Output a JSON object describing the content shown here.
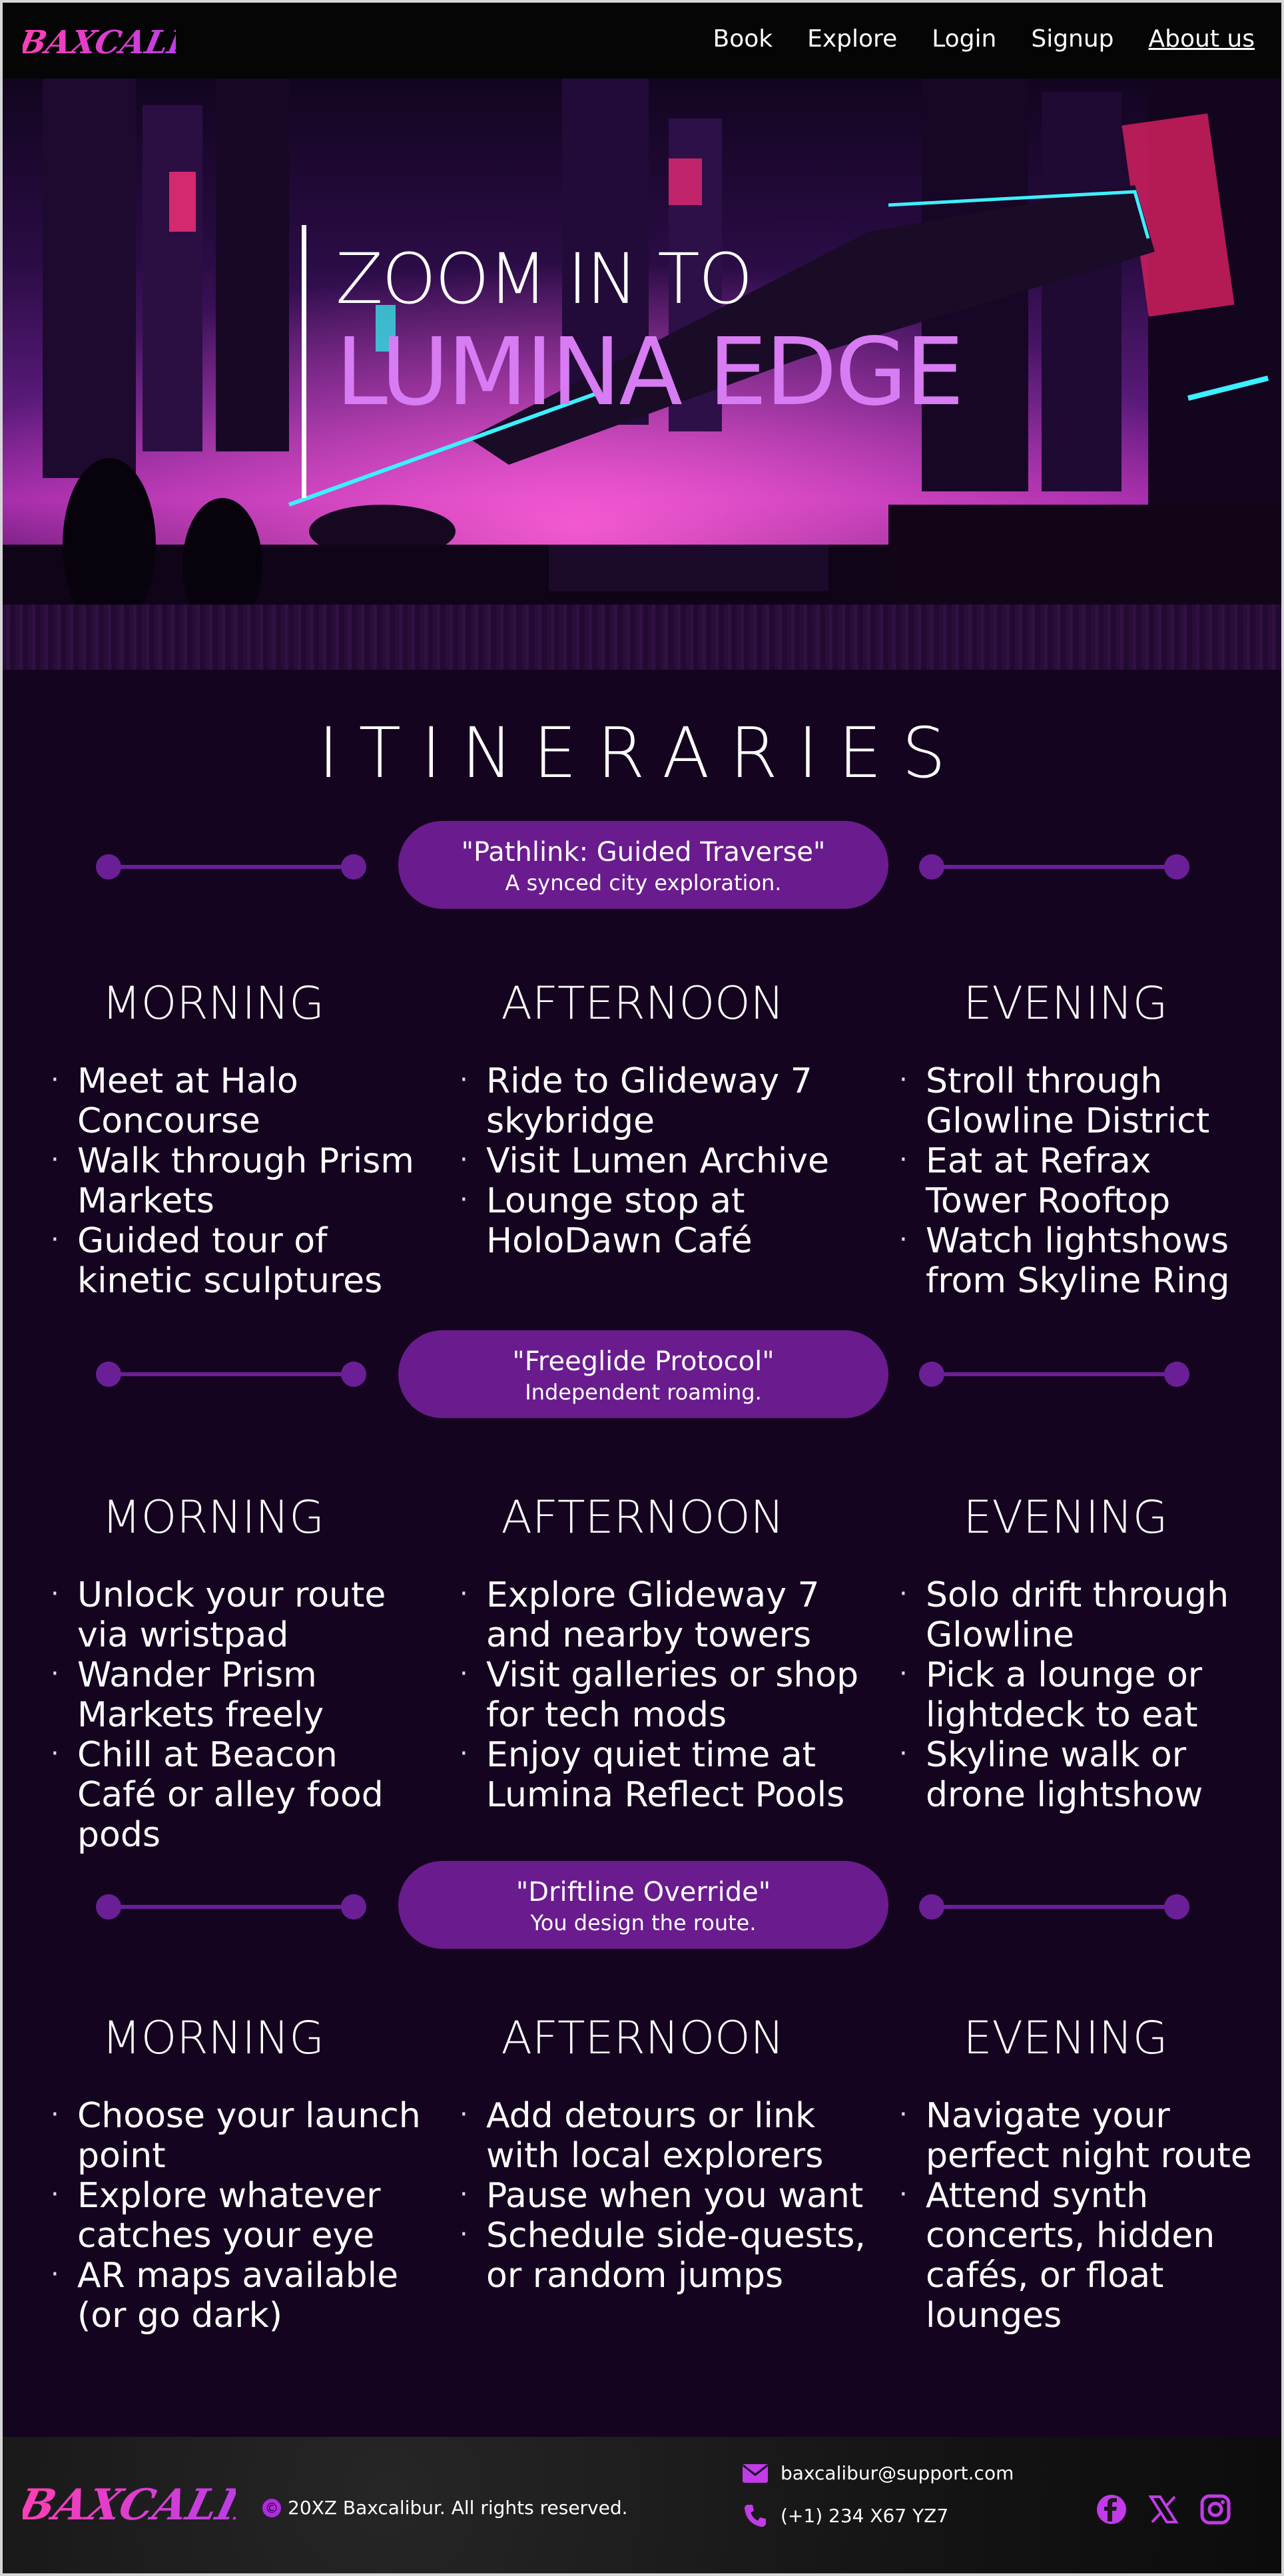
{
  "brand": {
    "name": "Baxcalibur",
    "logo_text": "BAXCALIBUR",
    "colors": {
      "accent": "#d77cf2",
      "pill": "#6a1b8e",
      "bg": "#14041f"
    }
  },
  "nav": {
    "links": [
      {
        "label": "Book"
      },
      {
        "label": "Explore"
      },
      {
        "label": "Login"
      },
      {
        "label": "Signup"
      },
      {
        "label": "About us",
        "active": true
      }
    ]
  },
  "hero": {
    "line1": "ZOOM IN TO",
    "line2": "LUMINA EDGE"
  },
  "section": {
    "title": "ITINERARIES"
  },
  "itineraries": [
    {
      "name": "\"Pathlink: Guided Traverse\"",
      "subtitle": "A synced city exploration.",
      "columns": [
        {
          "heading": "MORNING",
          "items": [
            "Meet at Halo Concourse",
            "Walk through Prism Markets",
            "Guided tour of kinetic sculptures"
          ]
        },
        {
          "heading": "AFTERNOON",
          "items": [
            "Ride to Glideway 7 skybridge",
            "Visit Lumen Archive",
            "Lounge stop at HoloDawn Café"
          ]
        },
        {
          "heading": "EVENING",
          "items": [
            "Stroll through Glowline District",
            "Eat at Refrax Tower Rooftop",
            "Watch lightshows from Skyline Ring"
          ]
        }
      ]
    },
    {
      "name": "\"Freeglide Protocol\"",
      "subtitle": "Independent roaming.",
      "columns": [
        {
          "heading": "MORNING",
          "items": [
            "Unlock your route via wristpad",
            "Wander Prism Markets freely",
            "Chill at Beacon Café or alley food pods"
          ]
        },
        {
          "heading": "AFTERNOON",
          "items": [
            "Explore Glideway 7 and nearby towers",
            "Visit galleries or shop for tech mods",
            "Enjoy quiet time at Lumina Reflect Pools"
          ]
        },
        {
          "heading": "EVENING",
          "items": [
            "Solo drift through Glowline",
            "Pick a lounge or lightdeck to eat",
            "Skyline walk or drone lightshow"
          ]
        }
      ]
    },
    {
      "name": "\"Driftline Override\"",
      "subtitle": "You design the route.",
      "columns": [
        {
          "heading": "MORNING",
          "items": [
            "Choose your launch point",
            "Explore whatever catches your eye",
            "AR maps available (or go dark)"
          ]
        },
        {
          "heading": "AFTERNOON",
          "items": [
            "Add detours or link with local explorers",
            "Pause when you want",
            "Schedule side-quests, or random jumps"
          ]
        },
        {
          "heading": "EVENING",
          "items": [
            "Navigate your perfect night route",
            "Attend synth concerts, hidden cafés, or float lounges"
          ]
        }
      ]
    }
  ],
  "footer": {
    "copyright": "20XZ Baxcalibur. All rights reserved.",
    "email": "baxcalibur@support.com",
    "phone": "(+1) 234 X67 YZ7",
    "social": [
      "facebook-icon",
      "x-icon",
      "instagram-icon"
    ]
  }
}
